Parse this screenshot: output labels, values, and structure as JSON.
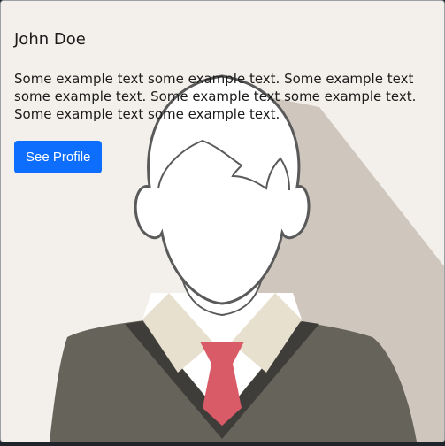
{
  "card": {
    "title": "John Doe",
    "text": "Some example text some example text. Some example text some example text. Some example text some example text. Some example text some example text.",
    "button_label": "See Profile"
  },
  "colors": {
    "background": "#f2efea",
    "shadow": "#cfc6bd",
    "sweater": "#66635b",
    "collar": "#e8e0cf",
    "tie": "#d95b67",
    "button": "#0d6efd"
  },
  "icons": {
    "avatar": "user-avatar-icon"
  }
}
